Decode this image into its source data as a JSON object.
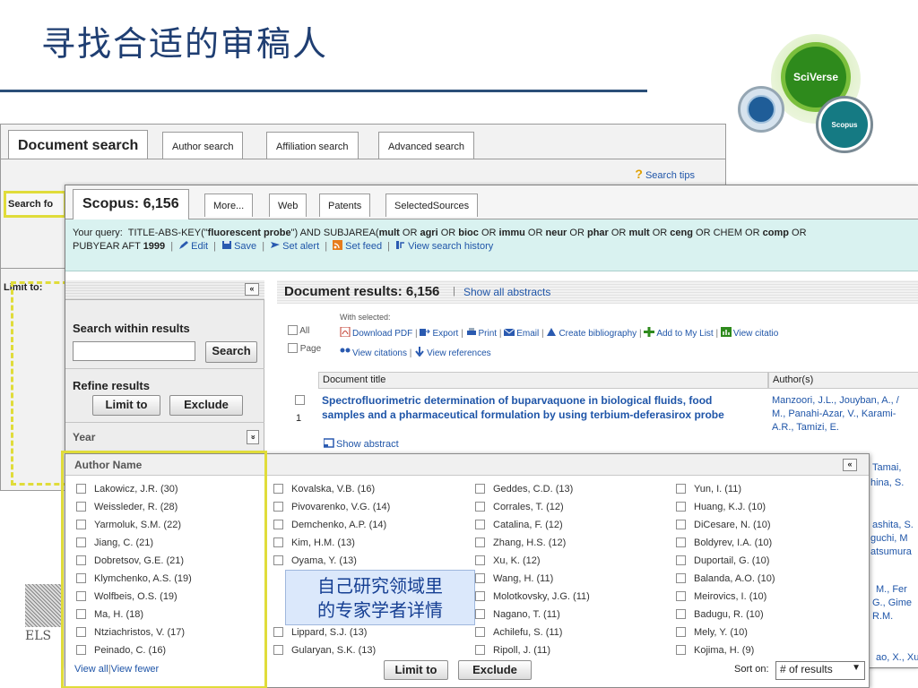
{
  "slide": {
    "title": "寻找合适的审稿人",
    "logo_main": "SciVerse",
    "logo_small": "Scopus"
  },
  "background_panel": {
    "tabs": [
      "Document search",
      "Author search",
      "Affiliation search",
      "Advanced search"
    ],
    "search_tips": "Search tips",
    "search_for_label": "Search fo",
    "limit_to_label": "Limit to:"
  },
  "scopus": {
    "tabs": [
      "Scopus: 6,156",
      "More...",
      "Web",
      "Patents",
      "SelectedSources"
    ],
    "query": {
      "your_query": "Your query:",
      "line1_parts": [
        "TITLE-ABS-KEY(\"",
        "fluorescent probe",
        "\") AND SUBJAREA(",
        "mult",
        " OR ",
        "agri",
        " OR ",
        "bioc",
        " OR ",
        "immu",
        " OR ",
        "neur",
        " OR ",
        "phar",
        " OR ",
        "mult",
        " OR ",
        "ceng",
        " OR CHEM OR ",
        "comp",
        " OR"
      ],
      "pubyear": "PUBYEAR AFT",
      "year": "1999",
      "actions": [
        "Edit",
        "Save",
        "Set alert",
        "Set feed",
        "View search history"
      ]
    },
    "sidebar": {
      "collapse": "«",
      "search_within_label": "Search within results",
      "search_input_value": "",
      "search_button": "Search",
      "refine_label": "Refine results",
      "limit_button": "Limit to",
      "exclude_button": "Exclude",
      "year_label": "Year",
      "year_toggle": "»"
    },
    "results": {
      "title": "Document results: 6,156",
      "show_all_abstracts": "Show all abstracts",
      "with_selected": "With selected:",
      "all_label": "All",
      "page_label": "Page",
      "actions_row1": [
        "Download PDF",
        "Export",
        "Print",
        "Email",
        "Create bibliography",
        "Add to My List",
        "View citatio"
      ],
      "actions_row2": [
        "View citations",
        "View references"
      ],
      "col_document_title": "Document title",
      "col_authors": "Author(s)",
      "first_doc": {
        "index": "1",
        "title_line1": "Spectrofluorimetric determination of buparvaquone in biological fluids, food",
        "title_line2": "samples and a pharmaceutical formulation by using terbium-deferasirox probe",
        "authors_line1": "Manzoori, J.L., Jouyban, A., /",
        "authors_line2": "M., Panahi-Azar, V., Karami-",
        "authors_line3": "A.R., Tamizi, E.",
        "show_abstract": "Show abstract"
      },
      "right_fragments": [
        "Tamai,",
        "hina, S.",
        "ashita, S.",
        "guchi, M",
        "atsumura",
        "M., Fer",
        "G., Gime",
        "R.M.",
        "ao, X., Xu"
      ]
    }
  },
  "author_popup": {
    "title": "Author Name",
    "collapse": "«",
    "columns": [
      [
        "Lakowicz, J.R. (30)",
        "Weissleder, R. (28)",
        "Yarmoluk, S.M. (22)",
        "Jiang, C. (21)",
        "Dobretsov, G.E. (21)",
        "Klymchenko, A.S. (19)",
        "Wolfbeis, O.S. (19)",
        "Ma, H. (18)",
        "Ntziachristos, V. (17)",
        "Peinado, C. (16)"
      ],
      [
        "Kovalska, V.B. (16)",
        "Pivovarenko, V.G. (14)",
        "Demchenko, A.P. (14)",
        "Kim, H.M. (13)",
        "Oyama, Y. (13)",
        "",
        "",
        "",
        "Lippard, S.J. (13)",
        "Gularyan, S.K. (13)"
      ],
      [
        "Geddes, C.D. (13)",
        "Corrales, T. (12)",
        "Catalina, F. (12)",
        "Zhang, H.S. (12)",
        "Xu, K. (12)",
        "Wang, H. (11)",
        "Molotkovsky, J.G. (11)",
        "Nagano, T. (11)",
        "Achilefu, S. (11)",
        "Ripoll, J. (11)"
      ],
      [
        "Yun, I. (11)",
        "Huang, K.J. (10)",
        "DiCesare, N. (10)",
        "Boldyrev, I.A. (10)",
        "Duportail, G. (10)",
        "Balanda, A.O. (10)",
        "Meirovics, I. (10)",
        "Badugu, R. (10)",
        "Mely, Y. (10)",
        "Kojima, H. (9)"
      ]
    ],
    "view_all": "View all",
    "view_fewer": "View fewer",
    "limit_button": "Limit to",
    "exclude_button": "Exclude",
    "sort_label": "Sort on:",
    "sort_value": "# of results"
  },
  "callout": {
    "line1": "自己研究领域里",
    "line2": "的专家学者详情"
  },
  "left_edge_fragment": "ELS",
  "colors": {
    "title_blue": "#1f3e72",
    "link_blue": "#1f55a8",
    "highlight_yellow": "#e0dc3a",
    "query_bg": "#d9f2f0"
  }
}
